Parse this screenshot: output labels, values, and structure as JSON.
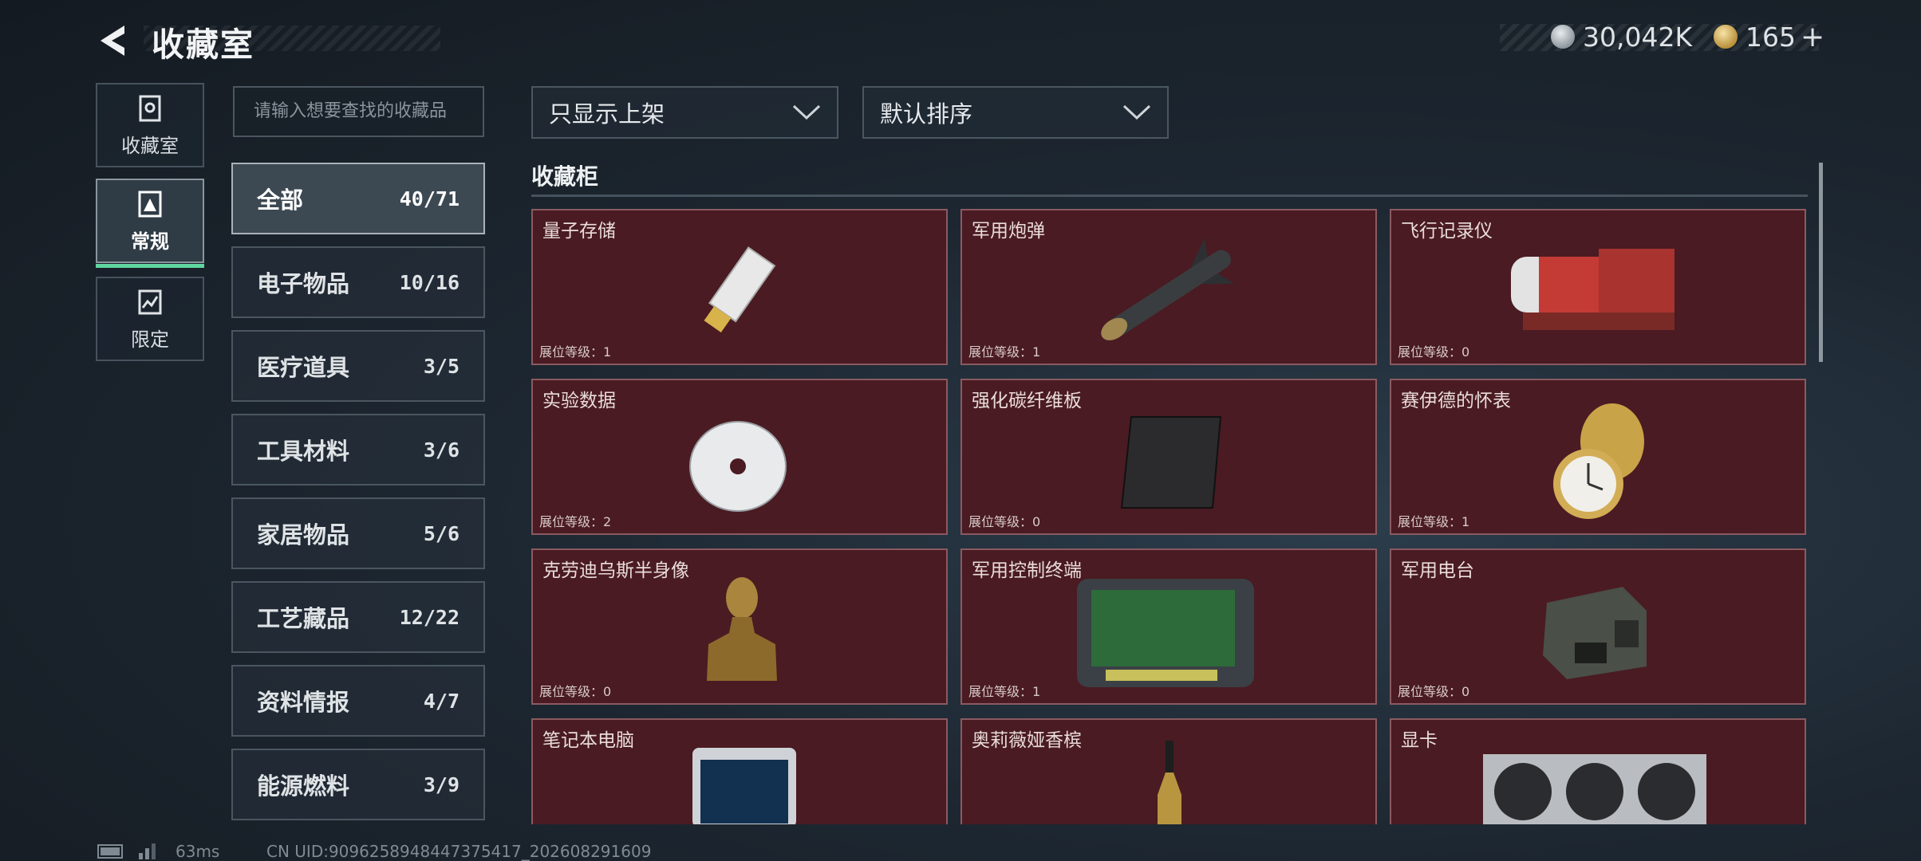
{
  "header": {
    "title": "收藏室",
    "currency_silver": "30,042K",
    "currency_gold": "165",
    "add_symbol": "+"
  },
  "nav": [
    {
      "label": "收藏室",
      "icon": "vault-icon",
      "active": false
    },
    {
      "label": "常规",
      "icon": "regular-icon",
      "active": true
    },
    {
      "label": "限定",
      "icon": "limited-icon",
      "active": false
    }
  ],
  "search": {
    "placeholder": "请输入想要查找的收藏品"
  },
  "categories": [
    {
      "label": "全部",
      "count": "40/71"
    },
    {
      "label": "电子物品",
      "count": "10/16"
    },
    {
      "label": "医疗道具",
      "count": "3/5"
    },
    {
      "label": "工具材料",
      "count": "3/6"
    },
    {
      "label": "家居物品",
      "count": "5/6"
    },
    {
      "label": "工艺藏品",
      "count": "12/22"
    },
    {
      "label": "资料情报",
      "count": "4/7"
    },
    {
      "label": "能源燃料",
      "count": "3/9"
    }
  ],
  "filters": {
    "show_filter": "只显示上架",
    "sort": "默认排序"
  },
  "section_title": "收藏柜",
  "items": [
    {
      "name": "量子存储",
      "level": "展位等级：1",
      "icon": "usb-drive-icon"
    },
    {
      "name": "军用炮弹",
      "level": "展位等级：1",
      "icon": "missile-icon"
    },
    {
      "name": "飞行记录仪",
      "level": "展位等级：0",
      "icon": "flight-recorder-icon"
    },
    {
      "name": "实验数据",
      "level": "展位等级：2",
      "icon": "disc-icon"
    },
    {
      "name": "强化碳纤维板",
      "level": "展位等级：0",
      "icon": "carbon-plate-icon"
    },
    {
      "name": "赛伊德的怀表",
      "level": "展位等级：1",
      "icon": "pocket-watch-icon"
    },
    {
      "name": "克劳迪乌斯半身像",
      "level": "展位等级：0",
      "icon": "bust-icon"
    },
    {
      "name": "军用控制终端",
      "level": "展位等级：1",
      "icon": "control-terminal-icon"
    },
    {
      "name": "军用电台",
      "level": "展位等级：0",
      "icon": "radio-icon"
    },
    {
      "name": "笔记本电脑",
      "level": "",
      "icon": "laptop-icon"
    },
    {
      "name": "奥莉薇娅香槟",
      "level": "",
      "icon": "champagne-icon"
    },
    {
      "name": "显卡",
      "level": "",
      "icon": "graphics-card-icon"
    }
  ],
  "status": {
    "ping": "63ms",
    "uid": "CN UID:9096258948447375417_202608291609"
  },
  "colors": {
    "card_bg": "#4a1b22",
    "card_border": "#8a5a60",
    "accent": "#5fd6a0"
  }
}
